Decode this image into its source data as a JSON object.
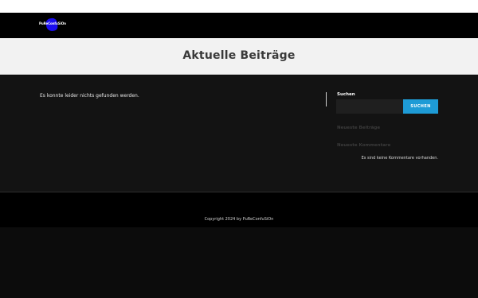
{
  "header": {
    "logo_text": "PuReConfuSiOn"
  },
  "hero": {
    "title": "Aktuelle Beiträge"
  },
  "main": {
    "not_found_text": "Es konnte leider nichts gefunden werden."
  },
  "sidebar": {
    "search_title": "Suchen",
    "search_value": "",
    "search_button": "SUCHEN",
    "recent_posts_title": "Neueste Beiträge",
    "recent_comments_title": "Neueste Kommentare",
    "no_comments_text": "Es sind keine Kommentare vorhanden."
  },
  "footer": {
    "copyright": "Copyright 2024 by PuReConfuSiOn"
  },
  "colors": {
    "accent": "#1e9bd6",
    "logo_blob": "#1a0df0",
    "background": "#131313",
    "hero_background": "#f2f2f2"
  },
  "icons": {
    "logo": "logo-blob-icon"
  }
}
